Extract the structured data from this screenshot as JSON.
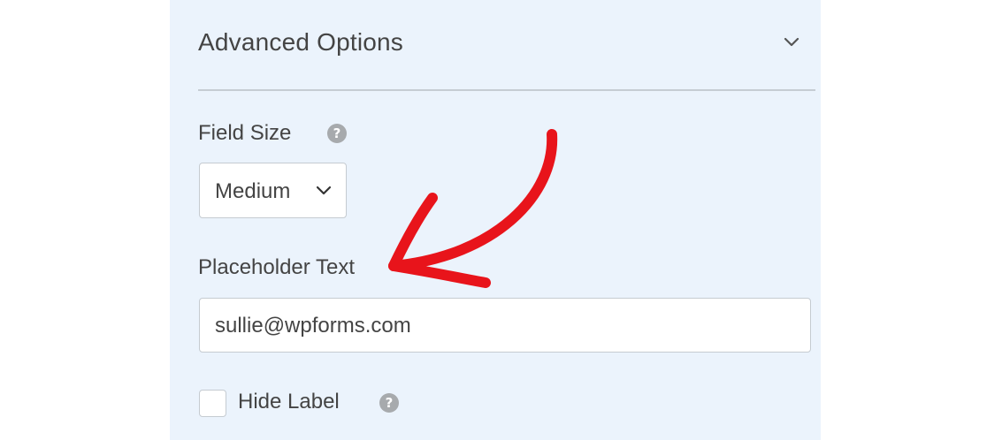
{
  "advanced_options": {
    "title": "Advanced Options",
    "toggle_icon": "chevron-down-icon"
  },
  "field_size": {
    "label": "Field Size",
    "help_icon": "help-icon",
    "help_glyph": "?",
    "selected": "Medium"
  },
  "placeholder_text": {
    "label": "Placeholder Text",
    "value": "sullie@wpforms.com"
  },
  "hide_label": {
    "label": "Hide Label",
    "checked": false,
    "help_glyph": "?"
  },
  "annotation": {
    "icon": "curved-arrow-icon",
    "color": "#e8141b"
  },
  "colors": {
    "panel_background": "#ebf3fc",
    "text": "#444444",
    "help_icon": "#a7aaad",
    "border": "#c5cbd1"
  }
}
